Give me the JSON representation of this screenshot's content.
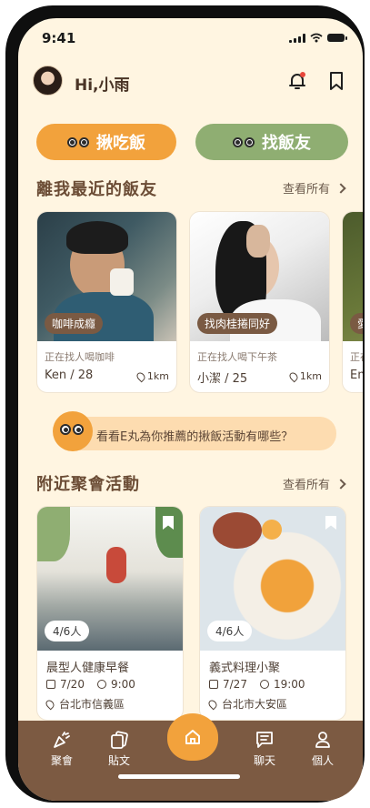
{
  "status": {
    "time": "9:41"
  },
  "header": {
    "greeting": "Hi,小雨"
  },
  "modes": {
    "eat": "揪吃飯",
    "friends": "找飯友"
  },
  "nearby_friends": {
    "title": "離我最近的飯友",
    "see_all": "查看所有",
    "items": [
      {
        "tag": "咖啡成癮",
        "status": "正在找人喝咖啡",
        "name": "Ken / 28",
        "distance": "1km"
      },
      {
        "tag": "找肉桂捲同好",
        "status": "正在找人喝下午茶",
        "name": "小潔 / 25",
        "distance": "1km"
      },
      {
        "tag": "愛",
        "status": "正在",
        "name": "Em",
        "distance": ""
      }
    ]
  },
  "recommendation": {
    "text": "看看E丸為你推薦的揪飯活動有哪些？"
  },
  "nearby_events": {
    "title": "附近聚會活動",
    "see_all": "查看所有",
    "items": [
      {
        "count": "4/6人",
        "title": "晨型人健康早餐",
        "date": "7/20",
        "time": "9:00",
        "location": "台北市信義區"
      },
      {
        "count": "4/6人",
        "title": "義式料理小聚",
        "date": "7/27",
        "time": "19:00",
        "location": "台北市大安區"
      }
    ]
  },
  "nav": {
    "gathering": "聚會",
    "posts": "貼文",
    "chat": "聊天",
    "profile": "個人"
  },
  "colors": {
    "background": "#fff5e1",
    "accent_orange": "#f2a23c",
    "accent_green": "#8fae72",
    "nav_brown": "#7c5a42"
  }
}
